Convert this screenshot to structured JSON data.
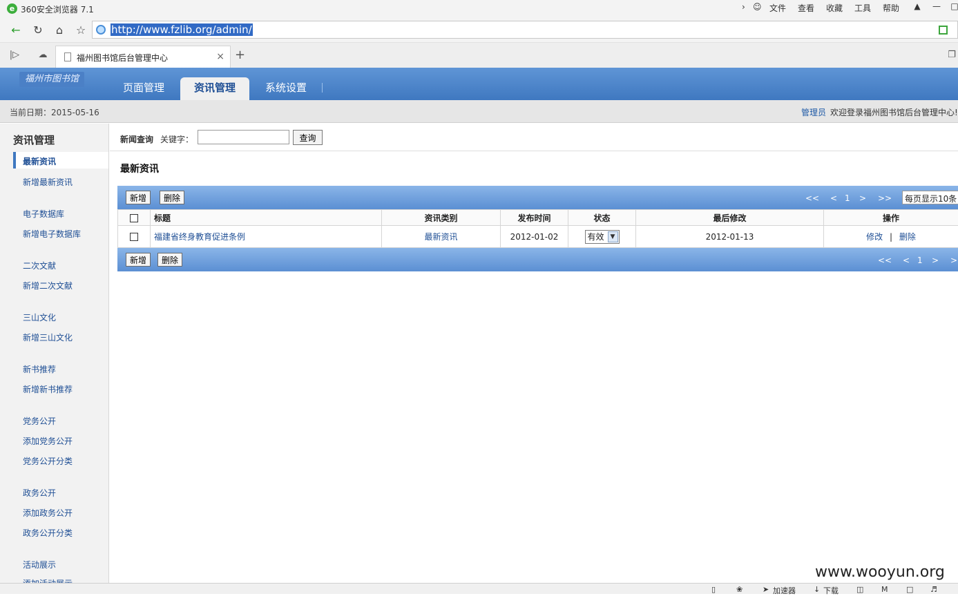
{
  "browser": {
    "title": "360安全浏览器 7.1",
    "menu": [
      "文件",
      "查看",
      "收藏",
      "工具",
      "帮助"
    ],
    "url": "http://www.fzlib.org/admin/",
    "tab_label": "福州图书馆后台管理中心"
  },
  "header": {
    "logo_text": "福州市图书馆",
    "nav": [
      "页面管理",
      "资讯管理",
      "系统设置"
    ]
  },
  "infobar": {
    "date": "当前日期：2015-05-16",
    "admin": "管理员",
    "welcome": "欢迎登录福州图书馆后台管理中心!"
  },
  "sidebar": {
    "title": "资讯管理",
    "items": [
      "最新资讯",
      "新增最新资讯",
      "电子数据库",
      "新增电子数据库",
      "二次文献",
      "新增二次文献",
      "三山文化",
      "新增三山文化",
      "新书推荐",
      "新增新书推荐",
      "党务公开",
      "添加党务公开",
      "党务公开分类",
      "政务公开",
      "添加政务公开",
      "政务公开分类",
      "活动展示",
      "添加活动展示"
    ]
  },
  "search": {
    "label_bold": "新闻查询",
    "label": "关键字：",
    "button": "查询"
  },
  "section_title": "最新资讯",
  "toolbar": {
    "add": "新增",
    "delete": "删除",
    "first": "<<",
    "prev": "<",
    "page": "1",
    "next": ">",
    "last": ">>",
    "page_size": "每页显示10条"
  },
  "table": {
    "headers": [
      "标题",
      "资讯类别",
      "发布时间",
      "状态",
      "最后修改",
      "操作"
    ],
    "rows": [
      {
        "title": "福建省终身教育促进条例",
        "category": "最新资讯",
        "published": "2012-01-02",
        "status": "有效",
        "modified": "2012-01-13",
        "edit": "修改",
        "sep": "|",
        "del": "删除"
      }
    ]
  },
  "statusbar": {
    "accelerator": "加速器",
    "download": "下载"
  },
  "watermark": "www.wooyun.org"
}
